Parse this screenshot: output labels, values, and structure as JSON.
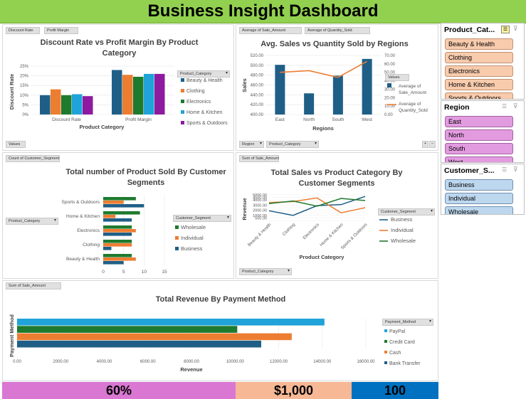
{
  "dashboard": {
    "title": "Business Insight Dashboard"
  },
  "colors": {
    "title_bar": "#92d050",
    "blue": "#1f5f87",
    "orange": "#ed7d31",
    "green": "#1e7a2e",
    "light_blue": "#1fa3d9",
    "purple": "#8e1aa0",
    "kpi_1": "#d977d2",
    "kpi_2": "#f7b896",
    "kpi_3": "#0070c0"
  },
  "chart1": {
    "pills": [
      "Discount Rate",
      "Profit Margin"
    ],
    "bottom_pill": "Values",
    "legend_header": "Product_Category",
    "chart_data": {
      "type": "bar",
      "title": "Discount Rate vs Profit Margin By Product Category",
      "xlabel": "Product Category",
      "ylabel": "Discount Rate",
      "categories": [
        "Discount Rate",
        "Profit Margin"
      ],
      "ylim": [
        0,
        0.25
      ],
      "yticks": [
        "0%",
        "5%",
        "10%",
        "15%",
        "20%",
        "25%"
      ],
      "series": [
        {
          "name": "Beauty & Health",
          "values": [
            0.1,
            0.23
          ]
        },
        {
          "name": "Clothing",
          "values": [
            0.13,
            0.205
          ]
        },
        {
          "name": "Electronics",
          "values": [
            0.1,
            0.195
          ]
        },
        {
          "name": "Home & Kitchen",
          "values": [
            0.105,
            0.21
          ]
        },
        {
          "name": "Sports & Outdoors",
          "values": [
            0.095,
            0.21
          ]
        }
      ]
    }
  },
  "chart2": {
    "pills": [
      "Average of Sale_Amount",
      "Average of Quantity_Sold"
    ],
    "bottom_pills": [
      "Region",
      "Product_Category"
    ],
    "legend_header": "Values",
    "chart_data": {
      "type": "bar",
      "title": "Avg. Sales vs Quantity Sold by Regions",
      "xlabel": "Regions",
      "ylabel": "Sales",
      "categories": [
        "East",
        "North",
        "South",
        "West"
      ],
      "ylim": [
        400,
        520
      ],
      "yticks": [
        "400.00",
        "420.00",
        "440.00",
        "460.00",
        "480.00",
        "500.00",
        "520.00"
      ],
      "y2lim": [
        0,
        70
      ],
      "y2ticks": [
        "0.00",
        "10.00",
        "20.00",
        "30.00",
        "40.00",
        "50.00",
        "60.00",
        "70.00"
      ],
      "series": [
        {
          "name": "Average of Sale_Amount",
          "type": "bar",
          "values": [
            501,
            443,
            479,
            513
          ]
        },
        {
          "name": "Average of Quantity_Sold",
          "type": "line",
          "values": [
            50,
            52,
            44,
            63
          ]
        }
      ]
    }
  },
  "chart3": {
    "pills": [
      "Count of Customer_Segment"
    ],
    "left_pill": "Product_Category",
    "legend_header": "Customer_Segment",
    "chart_data": {
      "type": "bar",
      "title": "Total number of Product Sold By Customer Segments",
      "orientation": "horizontal",
      "categories": [
        "Sports & Outdoors",
        "Home & Kitchen",
        "Electronics",
        "Clothing",
        "Beauty & Health"
      ],
      "xlim": [
        0,
        15
      ],
      "xticks": [
        "0",
        "5",
        "10",
        "15"
      ],
      "series": [
        {
          "name": "Wholesale",
          "values": [
            8,
            9,
            7,
            7,
            7
          ]
        },
        {
          "name": "Individual",
          "values": [
            5,
            3,
            8,
            7,
            8
          ]
        },
        {
          "name": "Business",
          "values": [
            10,
            7,
            7,
            2,
            5
          ]
        }
      ]
    }
  },
  "chart4": {
    "pills": [
      "Sum of Sale_Amount"
    ],
    "bottom_pill": "Product_Category",
    "legend_header": "Customer_Segment",
    "chart_data": {
      "type": "line",
      "title": "Total Sales vs Product Category By Customer Segments",
      "xlabel": "Product Category",
      "ylabel": "Revenue",
      "categories": [
        "Beauty & Health",
        "Clothing",
        "Electronics",
        "Home & Kitchen",
        "Sports & Outdoors"
      ],
      "ylim": [
        0,
        5000
      ],
      "yticks": [
        "0.00",
        "500.00",
        "1000.00",
        "1500.00",
        "2000.00",
        "2500.00",
        "3000.00",
        "3500.00",
        "4000.00",
        "4500.00",
        "5000.00"
      ],
      "series": [
        {
          "name": "Business",
          "values": [
            1900,
            1000,
            2900,
            3100,
            4700
          ]
        },
        {
          "name": "Individual",
          "values": [
            3500,
            3700,
            4400,
            1500,
            2500
          ]
        },
        {
          "name": "Wholesale",
          "values": [
            3300,
            3800,
            2800,
            4300,
            3900
          ]
        }
      ]
    }
  },
  "chart5": {
    "pills": [
      "Sum of Sale_Amount"
    ],
    "legend_header": "Payment_Method",
    "chart_data": {
      "type": "bar",
      "orientation": "horizontal",
      "title": "Total Revenue By Payment Method",
      "xlabel": "Revenue",
      "ylabel": "Payment Method",
      "xlim": [
        0,
        16000
      ],
      "xticks": [
        "0.00",
        "2000.00",
        "4000.00",
        "6000.00",
        "8000.00",
        "10000.00",
        "12000.00",
        "14000.00",
        "16000.00"
      ],
      "series": [
        {
          "name": "PayPal",
          "values": [
            14100
          ]
        },
        {
          "name": "Credit Card",
          "values": [
            10100
          ]
        },
        {
          "name": "Cash",
          "values": [
            12600
          ]
        },
        {
          "name": "Bank Transfer",
          "values": [
            11200
          ]
        }
      ]
    }
  },
  "slicers": {
    "product": {
      "header": "Product_Cat...",
      "items": [
        "Beauty & Health",
        "Clothing",
        "Electronics",
        "Home & Kitchen",
        "Sports & Outdoors"
      ],
      "fill": "#f8cbad",
      "border": "#c09070"
    },
    "region": {
      "header": "Region",
      "items": [
        "East",
        "North",
        "South",
        "West"
      ],
      "fill": "#e39be0",
      "border": "#a060a0"
    },
    "segment": {
      "header": "Customer_S...",
      "items": [
        "Business",
        "Individual",
        "Wholesale"
      ],
      "fill": "#bdd7ee",
      "border": "#7090b0"
    }
  },
  "kpis": [
    {
      "value": "60%"
    },
    {
      "value": "$1,000"
    },
    {
      "value": "100"
    }
  ]
}
